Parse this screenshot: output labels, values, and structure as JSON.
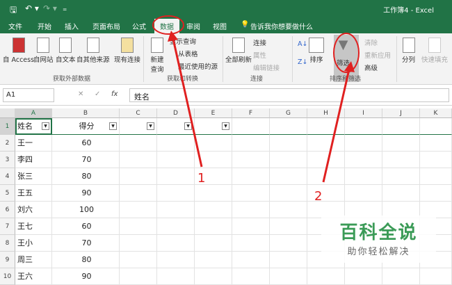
{
  "title": "工作簿4 - Excel",
  "quick": {
    "save": "🖫",
    "undo": "↶ ▾",
    "redo": "↷ ▾",
    "more": "₌"
  },
  "tabs": [
    "文件",
    "开始",
    "插入",
    "页面布局",
    "公式",
    "数据",
    "审阅",
    "视图"
  ],
  "tellme": "告诉我你想要做什么",
  "ribbon": {
    "external": [
      "自 Access",
      "自网站",
      "自文本",
      "自其他来源",
      "现有连接"
    ],
    "external_group": "获取外部数据",
    "new_query": "新建查询",
    "transform": [
      "显示查询",
      "从表格",
      "最近使用的源"
    ],
    "transform_group": "获取和转换",
    "refresh": "全部刷新",
    "conn": [
      "连接",
      "属性",
      "编辑链接"
    ],
    "conn_group": "连接",
    "sort": "排序",
    "filter": "筛选",
    "filter_side": [
      "清除",
      "重新应用",
      "高级"
    ],
    "sort_group": "排序和筛选",
    "split": "分列",
    "flash": "快速填充"
  },
  "formula": {
    "namebox": "A1",
    "cancel": "✕",
    "enter": "✓",
    "fx": "fx",
    "value": "姓名"
  },
  "columns": [
    "A",
    "B",
    "C",
    "D",
    "E",
    "F",
    "G",
    "H",
    "I",
    "J",
    "K"
  ],
  "header_row": {
    "a": "姓名",
    "b": "得分"
  },
  "rows": [
    [
      "王一",
      "60"
    ],
    [
      "李四",
      "70"
    ],
    [
      "张三",
      "80"
    ],
    [
      "王五",
      "90"
    ],
    [
      "刘六",
      "100"
    ],
    [
      "王七",
      "60"
    ],
    [
      "王小",
      "70"
    ],
    [
      "周三",
      "80"
    ],
    [
      "王六",
      "90"
    ]
  ],
  "annotations": [
    "1",
    "2"
  ],
  "watermark": {
    "main": "百科全说",
    "sub": "助你轻松解决"
  }
}
